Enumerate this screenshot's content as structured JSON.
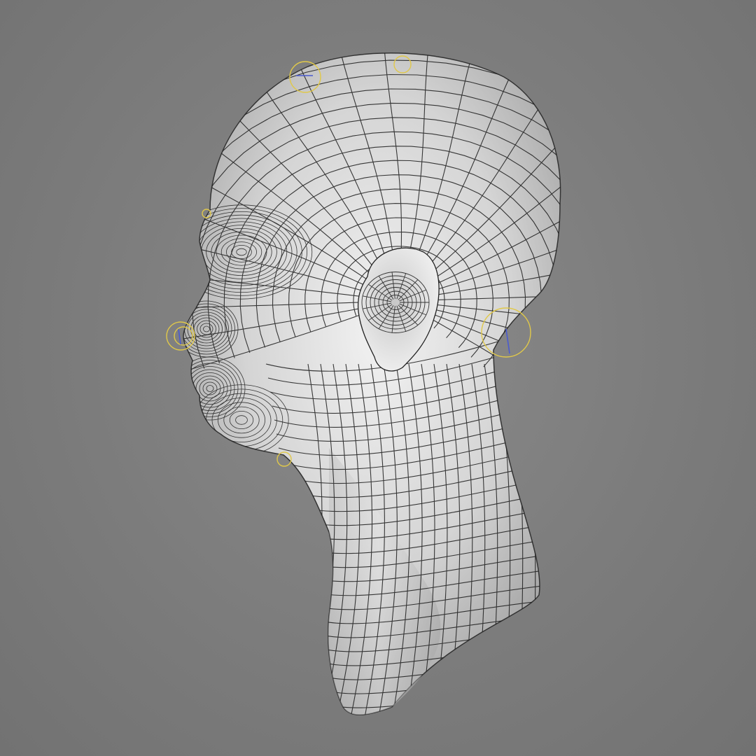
{
  "viewport": {
    "background": "#7f7f7f",
    "shading": "gray-clay",
    "display_mode": "wireframe-on-shaded"
  },
  "model": {
    "subject": "head-and-neck-mesh",
    "view": "left-profile",
    "surface_color": "#d9d9d9",
    "wire_color": "#1a1a1a"
  },
  "rig_controls": {
    "color": "#e0c84a",
    "count": 7
  }
}
